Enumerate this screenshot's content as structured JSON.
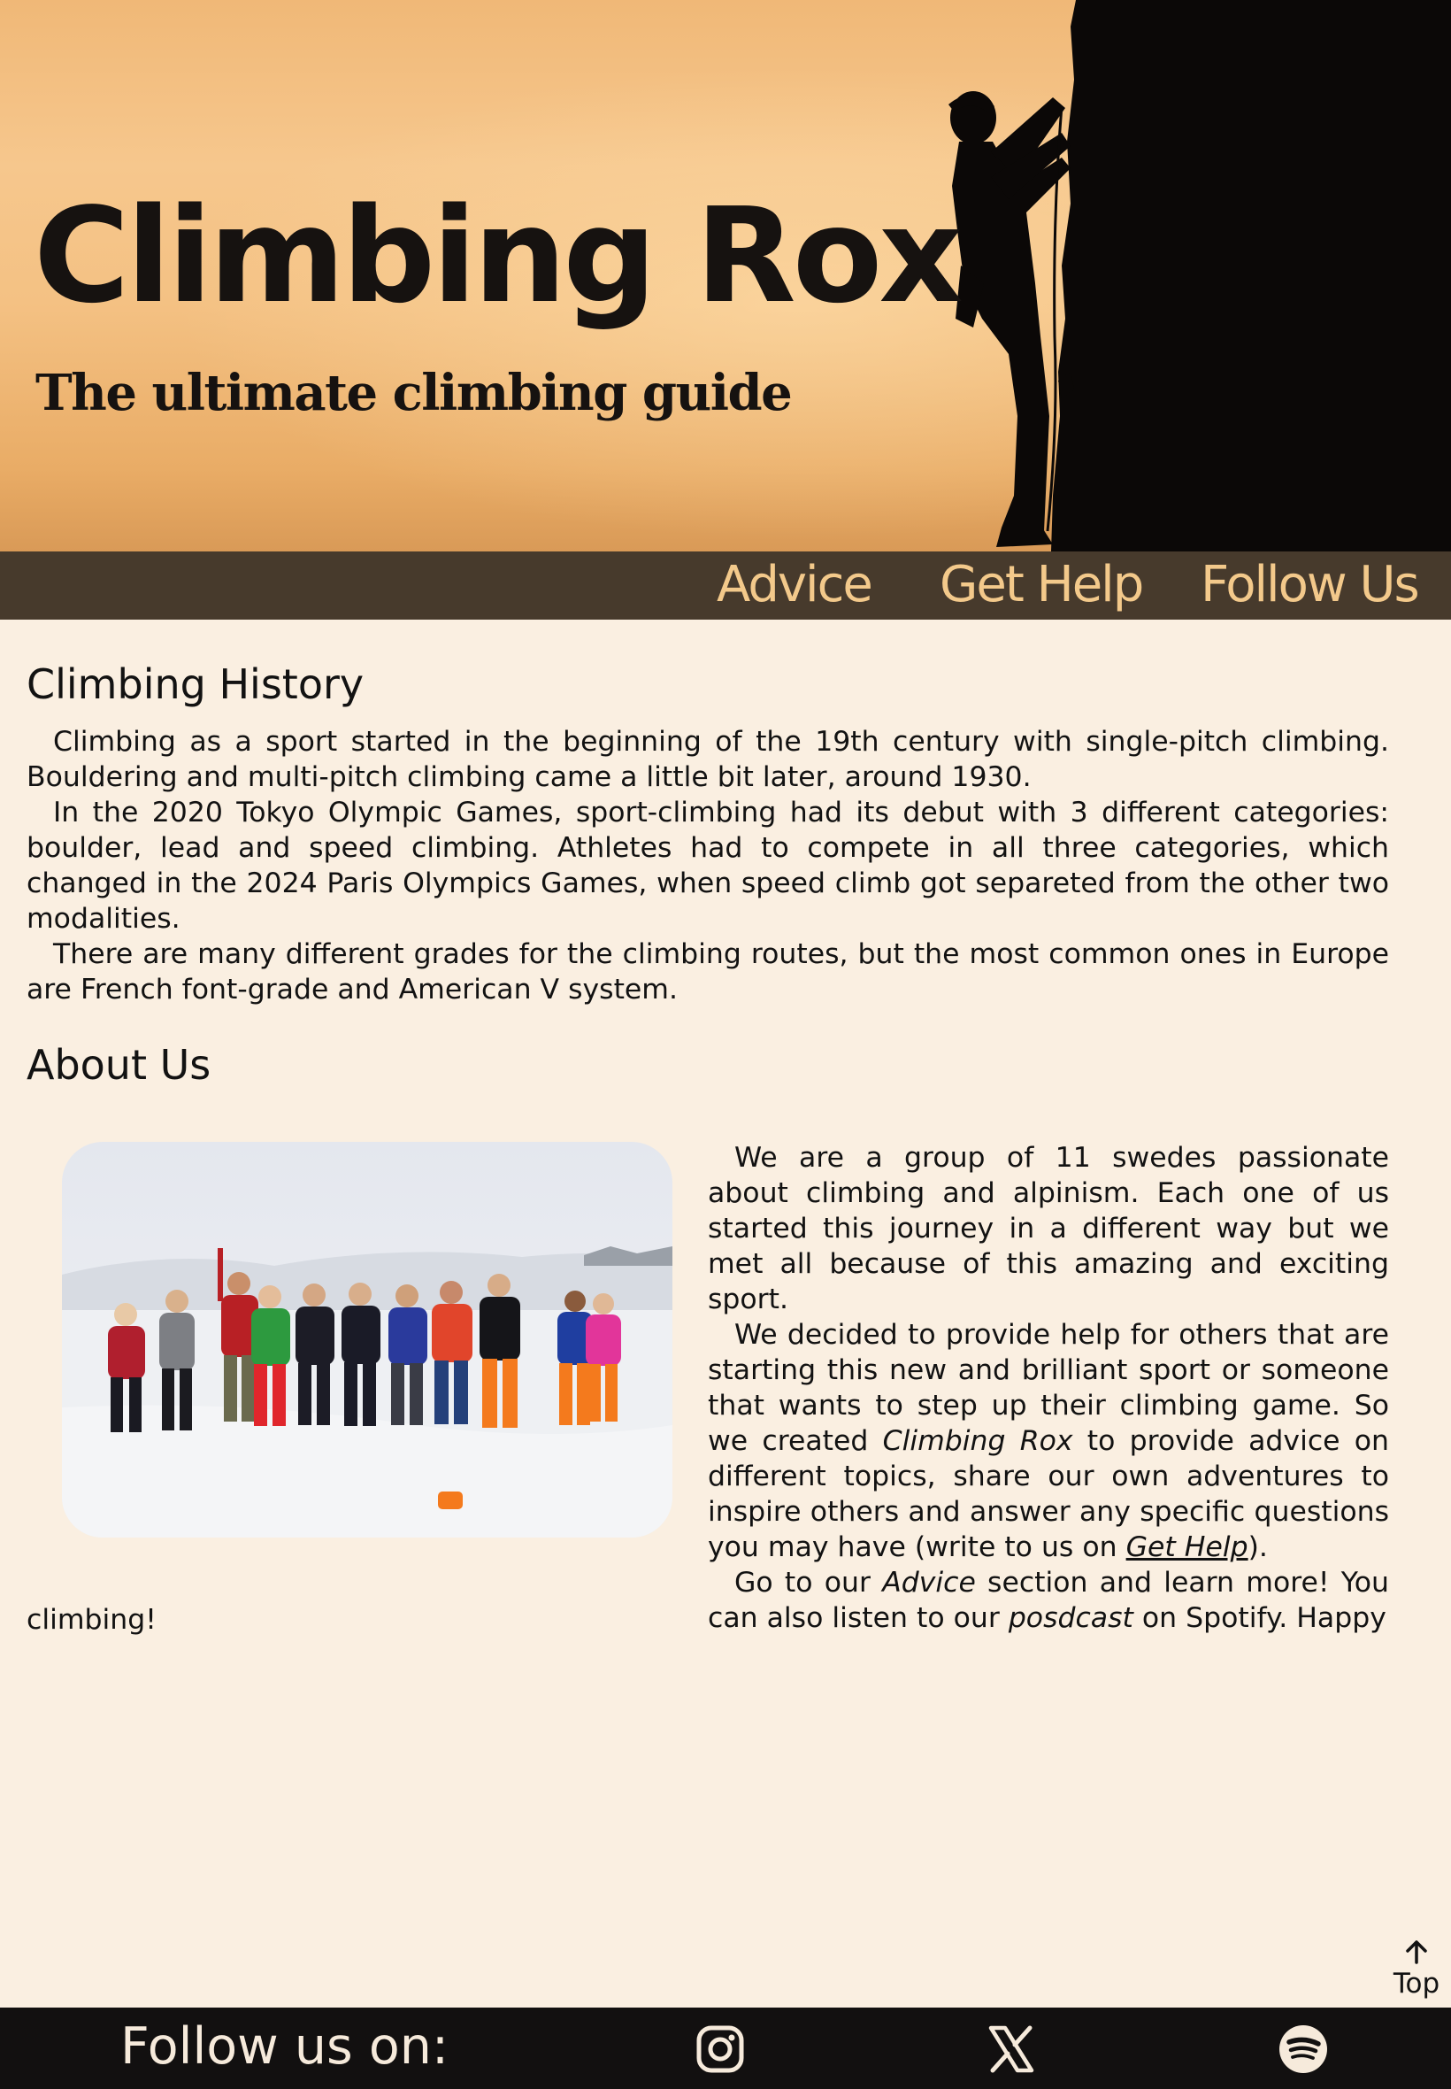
{
  "header": {
    "title": "Climbing Rox",
    "subtitle": "The ultimate climbing guide"
  },
  "nav": {
    "items": [
      {
        "label": "Advice"
      },
      {
        "label": "Get Help"
      },
      {
        "label": "Follow Us"
      }
    ]
  },
  "history": {
    "heading": "Climbing History",
    "paragraphs": [
      "Climbing as a sport started in the beginning of the 19th century with single-pitch climbing. Bouldering and multi-pitch climbing came a little bit later, around 1930.",
      "In the 2020 Tokyo Olympic Games, sport-climbing had its debut with 3 different categories: boulder, lead and speed climbing. Athletes had to compete in all three categories, which changed in the 2024 Paris Olympics Games, when speed climb got separeted from the other two modalities.",
      "There are many different grades for the climbing routes, but the most common ones in Europe are French font-grade and American V system."
    ]
  },
  "about": {
    "heading": "About Us",
    "p1": "We are a group of 11 swedes passionate about climbing and alpinism. Each one of us started this journey in a different way but we met all because of this amazing and exciting sport.",
    "p2_before": "We decided to provide help for others that are starting this new and brilliant sport or someone that wants to step up their climbing game. So we created ",
    "p2_em": "Climbing Rox",
    "p2_middle": " to provide advice on different topics, share our own adventures to inspire others and answer any specific questions you may have (write to us on ",
    "p2_link": "Get Help",
    "p2_after": ").",
    "p3_before": "Go to our ",
    "p3_em1": "Advice",
    "p3_middle": " section and learn more! You can also listen to our ",
    "p3_em2": "posdcast",
    "p3_after": " on Spotify. Happy",
    "closing": "climbing!"
  },
  "back_to_top": {
    "label": "Top",
    "icon": "arrow-up-icon"
  },
  "footer": {
    "label": "Follow us on:",
    "social": [
      "instagram-icon",
      "x-icon",
      "spotify-icon"
    ]
  },
  "colors": {
    "background": "#faefe1",
    "nav_bg": "#473a2c",
    "nav_text": "#f3c98b",
    "footer_bg": "#121010",
    "footer_text": "#f6eadb"
  }
}
